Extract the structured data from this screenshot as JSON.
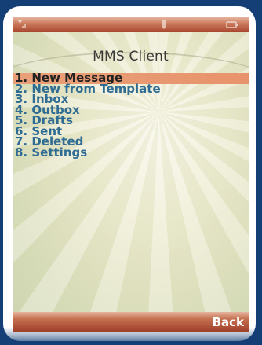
{
  "screen": {
    "title": "MMS Client"
  },
  "status_bar": {
    "icons": [
      "signal-icon",
      "message-icon",
      "battery-icon"
    ]
  },
  "menu": {
    "items": [
      {
        "label": "1. New Message",
        "selected": true
      },
      {
        "label": "2. New from Template",
        "selected": false
      },
      {
        "label": "3. Inbox",
        "selected": false
      },
      {
        "label": "4. Outbox",
        "selected": false
      },
      {
        "label": "5. Drafts",
        "selected": false
      },
      {
        "label": "6. Sent",
        "selected": false
      },
      {
        "label": "7. Deleted",
        "selected": false
      },
      {
        "label": "8. Settings",
        "selected": false
      }
    ]
  },
  "softkeys": {
    "right_label": "Back"
  },
  "colors": {
    "outer_background": "#133f76",
    "menu_text": "#2f6c93",
    "selection_highlight": "#e8936b",
    "softkey_bar": "#a8472f"
  }
}
